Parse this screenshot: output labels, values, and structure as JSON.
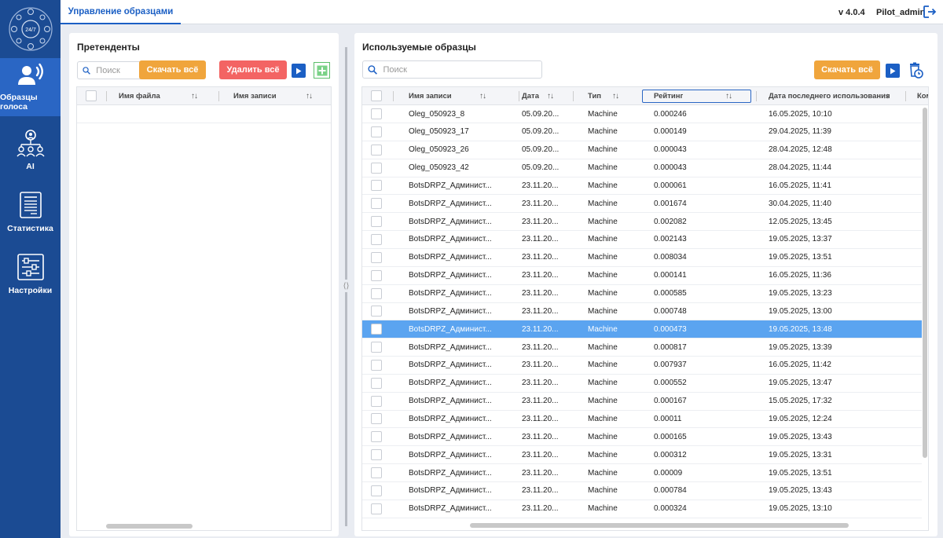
{
  "sidebar": {
    "logo_text": "24/7",
    "items": [
      {
        "label": "Образцы голоса",
        "icon": "voice-icon"
      },
      {
        "label": "AI",
        "icon": "users-network-icon"
      },
      {
        "label": "Статистика",
        "icon": "document-list-icon"
      },
      {
        "label": "Настройки",
        "icon": "sliders-icon"
      }
    ]
  },
  "topbar": {
    "tab_label": "Управление образцами",
    "version": "v 4.0.4",
    "username": "Pilot_admin"
  },
  "left_panel": {
    "title": "Претенденты",
    "search_placeholder": "Поиск",
    "download_all": "Скачать всё",
    "delete_all": "Удалить всё",
    "columns": [
      "Имя файла",
      "Имя записи"
    ],
    "sort_glyph": "↑↓"
  },
  "right_panel": {
    "title": "Используемые образцы",
    "search_placeholder": "Поиск",
    "download_all": "Скачать всё",
    "columns": [
      "Имя записи",
      "Дата",
      "Тип",
      "Рейтинг",
      "Дата последнего использования",
      "Ком"
    ],
    "sort_glyph": "↑↓",
    "rows": [
      {
        "name": "Oleg_050923_8",
        "date": "05.09.20...",
        "type": "Machine",
        "rating": "0.000246",
        "last_used": "16.05.2025, 10:10"
      },
      {
        "name": "Oleg_050923_17",
        "date": "05.09.20...",
        "type": "Machine",
        "rating": "0.000149",
        "last_used": "29.04.2025, 11:39"
      },
      {
        "name": "Oleg_050923_26",
        "date": "05.09.20...",
        "type": "Machine",
        "rating": "0.000043",
        "last_used": "28.04.2025, 12:48"
      },
      {
        "name": "Oleg_050923_42",
        "date": "05.09.20...",
        "type": "Machine",
        "rating": "0.000043",
        "last_used": "28.04.2025, 11:44"
      },
      {
        "name": "BotsDRPZ_Админист...",
        "date": "23.11.20...",
        "type": "Machine",
        "rating": "0.000061",
        "last_used": "16.05.2025, 11:41"
      },
      {
        "name": "BotsDRPZ_Админист...",
        "date": "23.11.20...",
        "type": "Machine",
        "rating": "0.001674",
        "last_used": "30.04.2025, 11:40"
      },
      {
        "name": "BotsDRPZ_Админист...",
        "date": "23.11.20...",
        "type": "Machine",
        "rating": "0.002082",
        "last_used": "12.05.2025, 13:45"
      },
      {
        "name": "BotsDRPZ_Админист...",
        "date": "23.11.20...",
        "type": "Machine",
        "rating": "0.002143",
        "last_used": "19.05.2025, 13:37"
      },
      {
        "name": "BotsDRPZ_Админист...",
        "date": "23.11.20...",
        "type": "Machine",
        "rating": "0.008034",
        "last_used": "19.05.2025, 13:51"
      },
      {
        "name": "BotsDRPZ_Админист...",
        "date": "23.11.20...",
        "type": "Machine",
        "rating": "0.000141",
        "last_used": "16.05.2025, 11:36"
      },
      {
        "name": "BotsDRPZ_Админист...",
        "date": "23.11.20...",
        "type": "Machine",
        "rating": "0.000585",
        "last_used": "19.05.2025, 13:23"
      },
      {
        "name": "BotsDRPZ_Админист...",
        "date": "23.11.20...",
        "type": "Machine",
        "rating": "0.000748",
        "last_used": "19.05.2025, 13:00"
      },
      {
        "name": "BotsDRPZ_Админист...",
        "date": "23.11.20...",
        "type": "Machine",
        "rating": "0.000473",
        "last_used": "19.05.2025, 13:48",
        "selected": true
      },
      {
        "name": "BotsDRPZ_Админист...",
        "date": "23.11.20...",
        "type": "Machine",
        "rating": "0.000817",
        "last_used": "19.05.2025, 13:39"
      },
      {
        "name": "BotsDRPZ_Админист...",
        "date": "23.11.20...",
        "type": "Machine",
        "rating": "0.007937",
        "last_used": "16.05.2025, 11:42"
      },
      {
        "name": "BotsDRPZ_Админист...",
        "date": "23.11.20...",
        "type": "Machine",
        "rating": "0.000552",
        "last_used": "19.05.2025, 13:47"
      },
      {
        "name": "BotsDRPZ_Админист...",
        "date": "23.11.20...",
        "type": "Machine",
        "rating": "0.000167",
        "last_used": "15.05.2025, 17:32"
      },
      {
        "name": "BotsDRPZ_Админист...",
        "date": "23.11.20...",
        "type": "Machine",
        "rating": "0.00011",
        "last_used": "19.05.2025, 12:24"
      },
      {
        "name": "BotsDRPZ_Админист...",
        "date": "23.11.20...",
        "type": "Machine",
        "rating": "0.000165",
        "last_used": "19.05.2025, 13:43"
      },
      {
        "name": "BotsDRPZ_Админист...",
        "date": "23.11.20...",
        "type": "Machine",
        "rating": "0.000312",
        "last_used": "19.05.2025, 13:31"
      },
      {
        "name": "BotsDRPZ_Админист...",
        "date": "23.11.20...",
        "type": "Machine",
        "rating": "0.00009",
        "last_used": "19.05.2025, 13:51"
      },
      {
        "name": "BotsDRPZ_Админист...",
        "date": "23.11.20...",
        "type": "Machine",
        "rating": "0.000784",
        "last_used": "19.05.2025, 13:43"
      },
      {
        "name": "BotsDRPZ_Админист...",
        "date": "23.11.20...",
        "type": "Machine",
        "rating": "0.000324",
        "last_used": "19.05.2025, 13:10"
      }
    ]
  },
  "colors": {
    "sidebar_bg": "#1b4b93",
    "sidebar_active": "#2a66c4",
    "accent_blue": "#1b5fc4",
    "orange_button": "#f0a53c",
    "red_button": "#f36463",
    "selected_row": "#5ba4f0"
  }
}
